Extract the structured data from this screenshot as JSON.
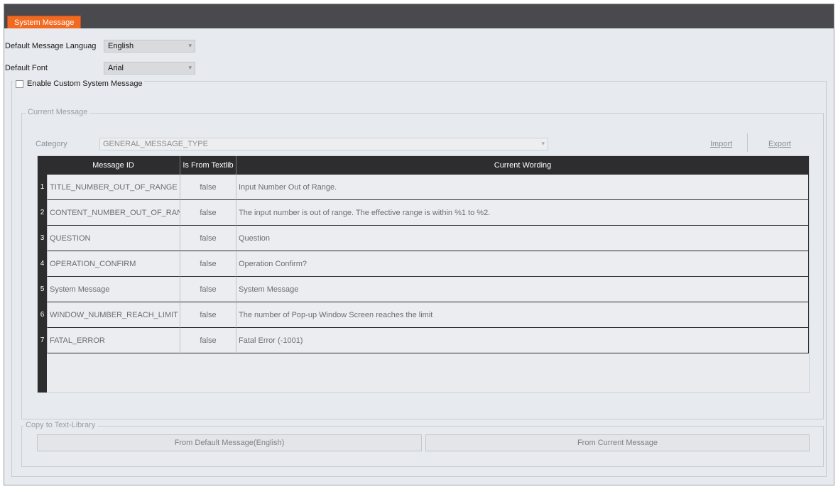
{
  "window": {
    "tab_title": "System Message"
  },
  "settings": {
    "language_label": "Default Message Languag",
    "language_value": "English",
    "font_label": "Default Font",
    "font_value": "Arial",
    "custom_checkbox_label": "Enable Custom System Message",
    "custom_checkbox_checked": false
  },
  "current_message": {
    "legend": "Current Message",
    "category_label": "Category",
    "category_value": "GENERAL_MESSAGE_TYPE",
    "import_label": "Import",
    "export_label": "Export",
    "columns": [
      "Message ID",
      "Is From Textlib",
      "Current Wording"
    ],
    "rows": [
      {
        "num": "1",
        "id": "TITLE_NUMBER_OUT_OF_RANGE",
        "from_textlib": "false",
        "wording": "Input Number Out of Range."
      },
      {
        "num": "2",
        "id": "CONTENT_NUMBER_OUT_OF_RANGE",
        "from_textlib": "false",
        "wording": "The input number is out of range. The effective range is within %1 to %2."
      },
      {
        "num": "3",
        "id": "QUESTION",
        "from_textlib": "false",
        "wording": "Question"
      },
      {
        "num": "4",
        "id": "OPERATION_CONFIRM",
        "from_textlib": "false",
        "wording": "Operation Confirm?"
      },
      {
        "num": "5",
        "id": "System Message",
        "from_textlib": "false",
        "wording": "System Message"
      },
      {
        "num": "6",
        "id": "WINDOW_NUMBER_REACH_LIMIT",
        "from_textlib": "false",
        "wording": "The number of Pop-up Window Screen reaches the limit"
      },
      {
        "num": "7",
        "id": "FATAL_ERROR",
        "from_textlib": "false",
        "wording": "Fatal Error (-1001)"
      }
    ]
  },
  "copy_group": {
    "legend": "Copy to Text-Library",
    "from_default_label": "From Default Message(English)",
    "from_current_label": "From Current Message"
  },
  "colors": {
    "tab_accent": "#f26a21",
    "titlebar": "#4a4a4e",
    "grid_header": "#2d2d2f",
    "panel_background": "#e7eaee"
  },
  "icons": {
    "combo_arrow": "chevron-down-icon"
  }
}
